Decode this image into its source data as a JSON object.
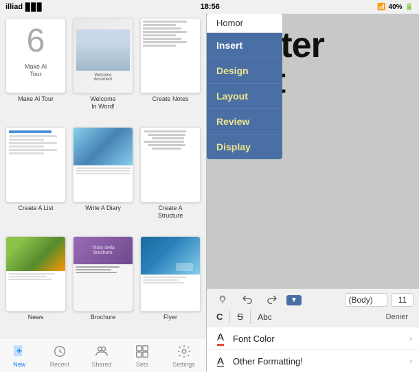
{
  "statusBar": {
    "carrier": "illiad",
    "time": "18:56",
    "batteryIcon": "🔋",
    "batteryPercent": "40%"
  },
  "leftPanel": {
    "templates": [
      {
        "id": "make-al-tour",
        "label": "Make Al\nTour",
        "type": "number6"
      },
      {
        "id": "welcome-in-word",
        "label": "Welcome\nIn Word!",
        "type": "welcome"
      },
      {
        "id": "create-notes",
        "label": "Create Notes",
        "type": "notes"
      },
      {
        "id": "create-a-list",
        "label": "Create A List",
        "type": "list"
      },
      {
        "id": "write-a-diary",
        "label": "Write A Diary",
        "type": "diary"
      },
      {
        "id": "create-a-structure",
        "label": "Create A\nStructure",
        "type": "structure"
      },
      {
        "id": "news",
        "label": "News",
        "type": "news"
      },
      {
        "id": "brochure",
        "label": "Brochure",
        "type": "brochure"
      },
      {
        "id": "flyer",
        "label": "Flyer",
        "type": "flyer"
      }
    ]
  },
  "tabBar": {
    "tabs": [
      {
        "id": "new",
        "label": "New",
        "icon": "new-icon",
        "active": true
      },
      {
        "id": "recent",
        "label": "Recent",
        "icon": "recent-icon",
        "active": false
      },
      {
        "id": "shared",
        "label": "Shared",
        "icon": "shared-icon",
        "active": false
      },
      {
        "id": "sets",
        "label": "Sets",
        "icon": "sets-icon",
        "active": false
      },
      {
        "id": "settings",
        "label": "Settings",
        "icon": "settings-icon",
        "active": false
      }
    ]
  },
  "rightPanel": {
    "docText": {
      "line1": "Poster",
      "line2": "Test"
    },
    "dropdown": {
      "header": "Homor",
      "items": [
        {
          "id": "insert",
          "label": "Insert",
          "active": true
        },
        {
          "id": "design",
          "label": "Design",
          "active": false
        },
        {
          "id": "layout",
          "label": "Layout",
          "active": false
        },
        {
          "id": "review",
          "label": "Review",
          "active": false
        },
        {
          "id": "display",
          "label": "Display",
          "active": false
        }
      ]
    },
    "toolbar": {
      "undoLabel": "↩",
      "redoLabel": "↪",
      "fontName": "(Body)",
      "fontSize": "11",
      "boldLabel": "C",
      "strikeLabel": "S",
      "abcLabel": "Abc",
      "fontColorLabel": "Font Color",
      "otherFormattingLabel": "Other Formatting!"
    }
  }
}
